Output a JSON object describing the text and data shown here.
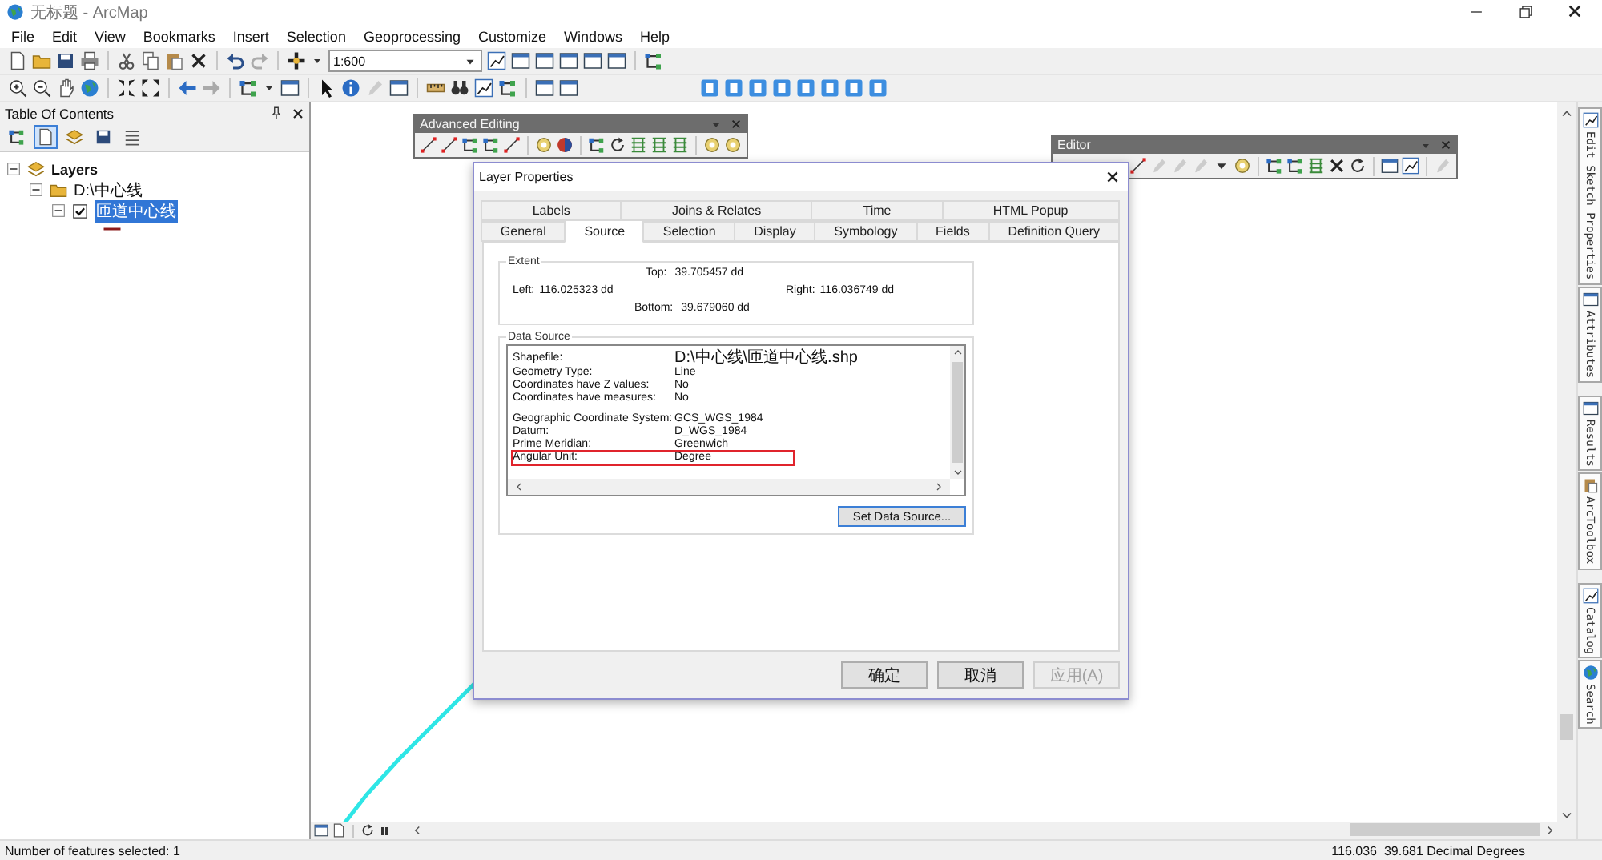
{
  "window": {
    "title": "无标题 - ArcMap"
  },
  "menu": [
    "File",
    "Edit",
    "View",
    "Bookmarks",
    "Insert",
    "Selection",
    "Geoprocessing",
    "Customize",
    "Windows",
    "Help"
  ],
  "scale_field": {
    "value": "1:600"
  },
  "toc": {
    "title": "Table Of Contents",
    "view_buttons": [
      {
        "selected": false
      },
      {
        "selected": true
      },
      {
        "selected": false
      },
      {
        "selected": false
      },
      {
        "selected": false
      }
    ],
    "layers": [
      {
        "label": "Layers",
        "expanded": true,
        "children": [
          {
            "label": "D:\\中心线",
            "expanded": true,
            "children": [
              {
                "label": "匝道中心线",
                "expanded": true,
                "checked": true,
                "selected": true
              }
            ]
          }
        ]
      }
    ]
  },
  "advanced_editing": {
    "title": "Advanced Editing"
  },
  "editor_toolbar": {
    "title": "Editor"
  },
  "dialog": {
    "title": "Layer Properties",
    "tab_rows": [
      [
        {
          "label": "Labels",
          "selected": false
        },
        {
          "label": "Joins & Relates",
          "selected": false
        },
        {
          "label": "Time",
          "selected": false
        },
        {
          "label": "HTML Popup",
          "selected": false
        }
      ],
      [
        {
          "label": "General",
          "selected": false
        },
        {
          "label": "Source",
          "selected": true
        },
        {
          "label": "Selection",
          "selected": false
        },
        {
          "label": "Display",
          "selected": false
        },
        {
          "label": "Symbology",
          "selected": false
        },
        {
          "label": "Fields",
          "selected": false
        },
        {
          "label": "Definition Query",
          "selected": false
        }
      ]
    ],
    "extent": {
      "legend": "Extent",
      "top": {
        "label": "Top:",
        "value": "39.705457 dd"
      },
      "left": {
        "label": "Left:",
        "value": "116.025323 dd"
      },
      "right": {
        "label": "Right:",
        "value": "116.036749 dd"
      },
      "bottom": {
        "label": "Bottom:",
        "value": "39.679060 dd"
      }
    },
    "data_source": {
      "legend": "Data Source",
      "groups": [
        [
          {
            "label": "Shapefile:",
            "value": "D:\\中心线\\匝道中心线.shp",
            "highlighted": false
          },
          {
            "label": "Geometry Type:",
            "value": "Line",
            "highlighted": false
          },
          {
            "label": "Coordinates have Z values:",
            "value": "No",
            "highlighted": false
          },
          {
            "label": "Coordinates have measures:",
            "value": "No",
            "highlighted": false
          }
        ],
        [
          {
            "label": "Geographic Coordinate System:",
            "value": "GCS_WGS_1984",
            "highlighted": false
          },
          {
            "label": "Datum:",
            "value": "D_WGS_1984",
            "highlighted": false
          },
          {
            "label": "Prime Meridian:",
            "value": "Greenwich",
            "highlighted": false
          },
          {
            "label": "Angular Unit:",
            "value": "Degree",
            "highlighted": true
          }
        ]
      ],
      "button": "Set Data Source..."
    },
    "buttons": [
      {
        "label": "确定",
        "disabled": false
      },
      {
        "label": "取消",
        "disabled": false
      },
      {
        "label": "应用(A)",
        "disabled": true
      }
    ]
  },
  "dock_tabs": [
    [
      "Edit Sketch Properties",
      "Attributes"
    ],
    [
      "Results",
      "ArcToolbox"
    ],
    [
      "Catalog",
      "Search"
    ]
  ],
  "status_bar": {
    "selection": "Number of features selected: 1",
    "coordinates": "116.036  39.681 Decimal Degrees"
  }
}
